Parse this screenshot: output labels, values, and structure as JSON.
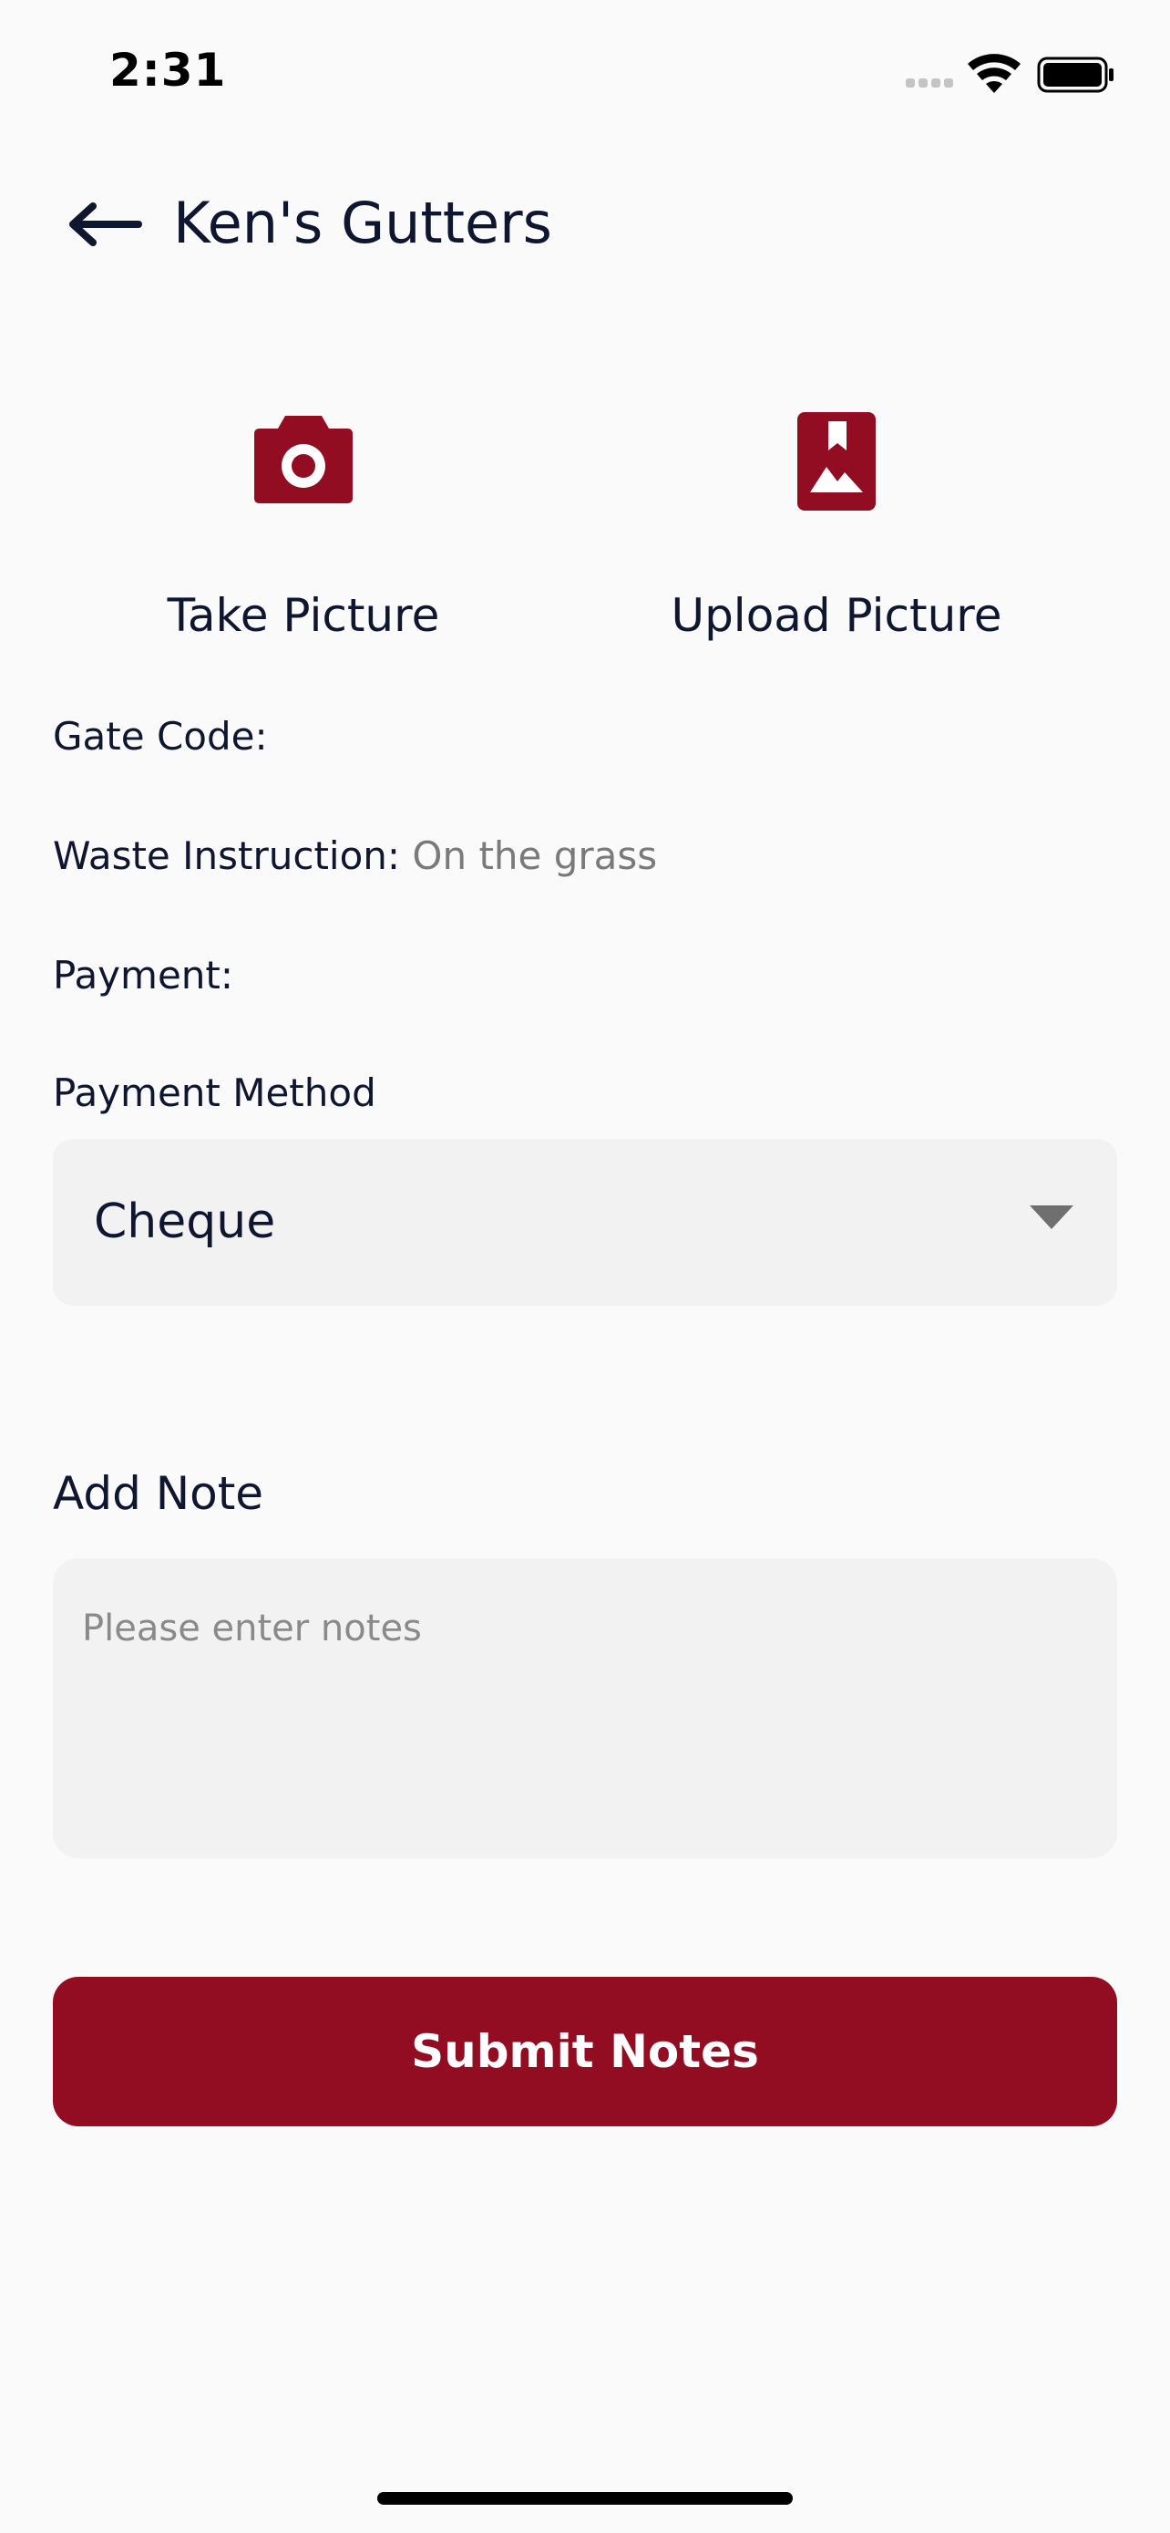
{
  "status_bar": {
    "time": "2:31",
    "icons": [
      "cellular-signal-icon",
      "wifi-icon",
      "battery-icon"
    ]
  },
  "header": {
    "title": "Ken's Gutters",
    "back_icon": "arrow-left-icon"
  },
  "picture_actions": {
    "take": {
      "label": "Take Picture",
      "icon": "camera-icon"
    },
    "upload": {
      "label": "Upload Picture",
      "icon": "image-upload-icon"
    }
  },
  "details": {
    "gate_code_label": "Gate Code:",
    "gate_code_value": "",
    "waste_instruction_label": "Waste Instruction:",
    "waste_instruction_value": "On the grass",
    "payment_label": "Payment:",
    "payment_value": ""
  },
  "payment_method": {
    "label": "Payment Method",
    "selected": "Cheque"
  },
  "note": {
    "label": "Add Note",
    "placeholder": "Please enter notes",
    "value": ""
  },
  "submit": {
    "label": "Submit Notes"
  },
  "colors": {
    "brand": "#920c22",
    "text": "#0f1630",
    "muted": "#7a7a7a",
    "field_bg": "#f2f2f2",
    "background": "#fafafa"
  }
}
